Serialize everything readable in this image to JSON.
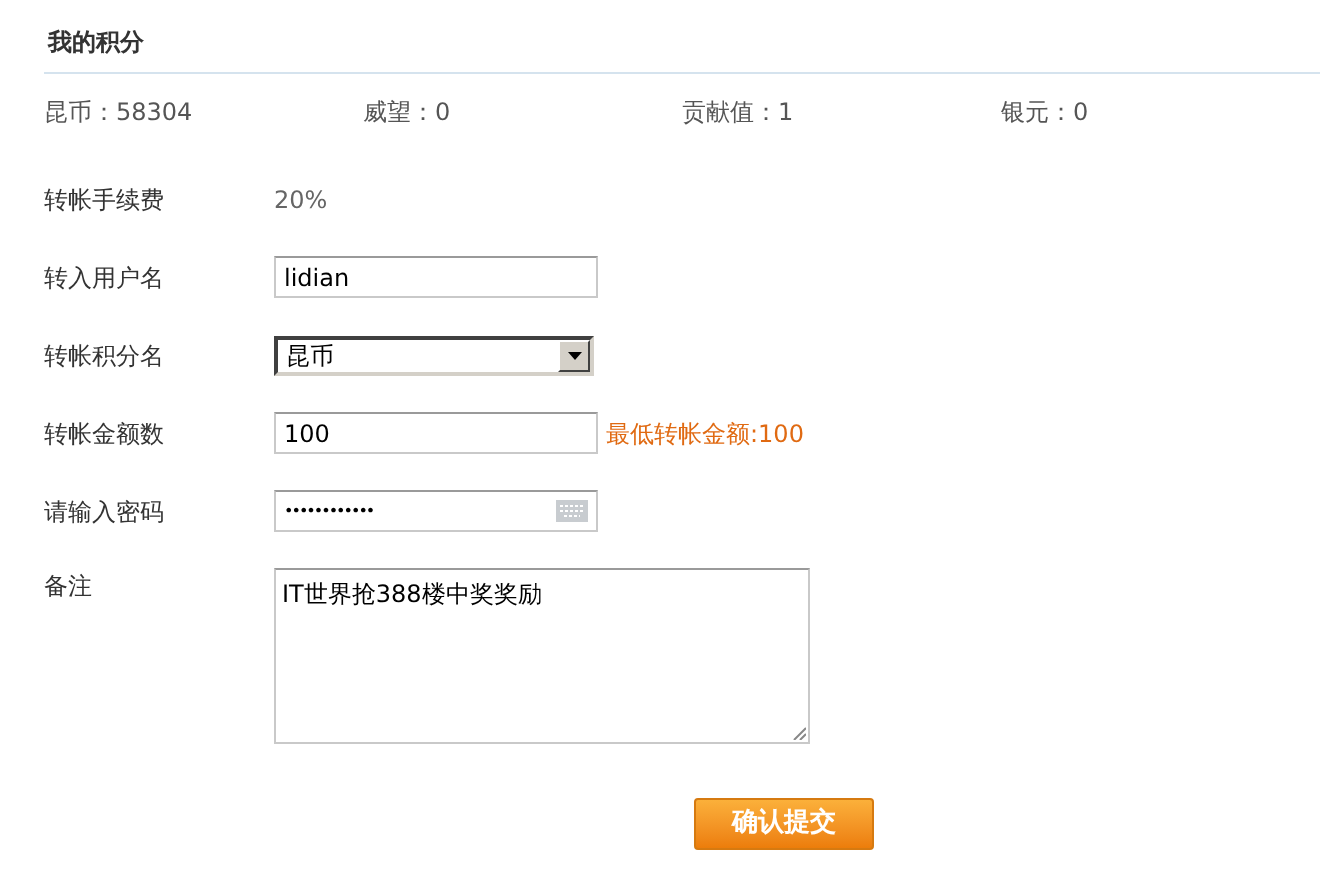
{
  "section_title": "我的积分",
  "stats": [
    {
      "label": "昆币：",
      "value": "58304"
    },
    {
      "label": "威望：",
      "value": "0"
    },
    {
      "label": "贡献值：",
      "value": "1"
    },
    {
      "label": "银元：",
      "value": "0"
    }
  ],
  "form": [
    {
      "kind": "text",
      "label": "转帐手续费",
      "value": "20%"
    },
    {
      "kind": "input",
      "label": "转入用户名",
      "value": "lidian"
    },
    {
      "kind": "select",
      "label": "转帐积分名",
      "value": "昆币"
    },
    {
      "kind": "input",
      "label": "转帐金额数",
      "value": "100",
      "hint": "最低转帐金额:100"
    },
    {
      "kind": "password",
      "label": "请输入密码",
      "value": "••••••••••••"
    },
    {
      "kind": "textarea",
      "label": "备注",
      "value": "IT世界抢388楼中奖奖励"
    }
  ],
  "submit": "确认提交"
}
